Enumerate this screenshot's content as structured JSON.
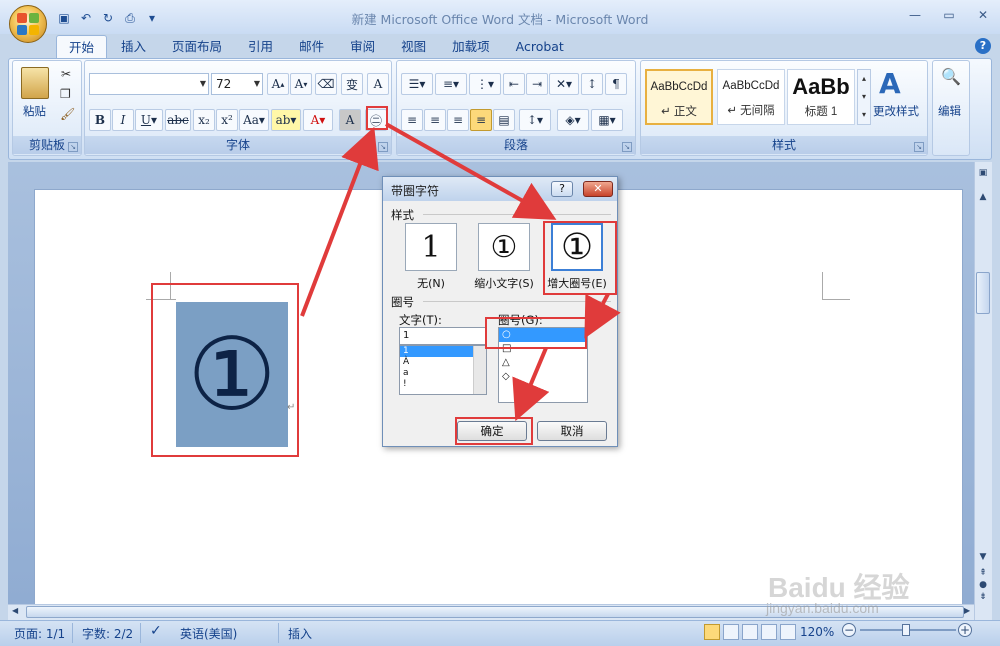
{
  "window": {
    "title": "新建 Microsoft Office Word 文档 - Microsoft Word",
    "controls": [
      "minimize",
      "maximize",
      "close"
    ]
  },
  "tabs": [
    {
      "label": "开始",
      "active": true
    },
    {
      "label": "插入"
    },
    {
      "label": "页面布局"
    },
    {
      "label": "引用"
    },
    {
      "label": "邮件"
    },
    {
      "label": "审阅"
    },
    {
      "label": "视图"
    },
    {
      "label": "加载项"
    },
    {
      "label": "Acrobat"
    }
  ],
  "ribbon": {
    "clipboard": {
      "label": "剪贴板",
      "paste": "粘贴"
    },
    "font": {
      "label": "字体",
      "font_name": "",
      "font_size": "72"
    },
    "paragraph": {
      "label": "段落"
    },
    "styles": {
      "label": "样式",
      "items": [
        {
          "preview": "AaBbCcDd",
          "name": "↵ 正文",
          "selected": true
        },
        {
          "preview": "AaBbCcDd",
          "name": "↵ 无间隔"
        },
        {
          "preview": "AaBb",
          "name": "标题 1"
        }
      ],
      "change_styles": "更改样式"
    },
    "editing": {
      "label": "编辑"
    }
  },
  "document": {
    "character": "①",
    "paragraph_mark": "↵"
  },
  "dialog": {
    "title": "带圈字符",
    "help": "?",
    "close": "✕",
    "style_label": "样式",
    "options": [
      {
        "glyph": "1",
        "caption": "无(N)"
      },
      {
        "glyph": "①",
        "caption": "缩小文字(S)"
      },
      {
        "glyph": "①",
        "caption": "增大圈号(E)",
        "selected": true
      }
    ],
    "enclosure_label": "圈号",
    "text_label": "文字(T):",
    "text_value": "1",
    "text_list": [
      "1",
      "À",
      "a",
      "!"
    ],
    "enclosure_list_label": "圈号(G):",
    "enclosure_list": [
      "○",
      "□",
      "△",
      "◇"
    ],
    "ok": "确定",
    "cancel": "取消"
  },
  "statusbar": {
    "page": "页面: 1/1",
    "words": "字数: 2/2",
    "language": "英语(美国)",
    "mode": "插入",
    "zoom": "120%"
  },
  "watermark": {
    "text": "Baidu 经验",
    "sub": "jingyan.baidu.com"
  },
  "colors": {
    "annotation": "#e03b3b",
    "selection": "#3399ff",
    "highlight_char_bg": "#7b9fc4"
  }
}
